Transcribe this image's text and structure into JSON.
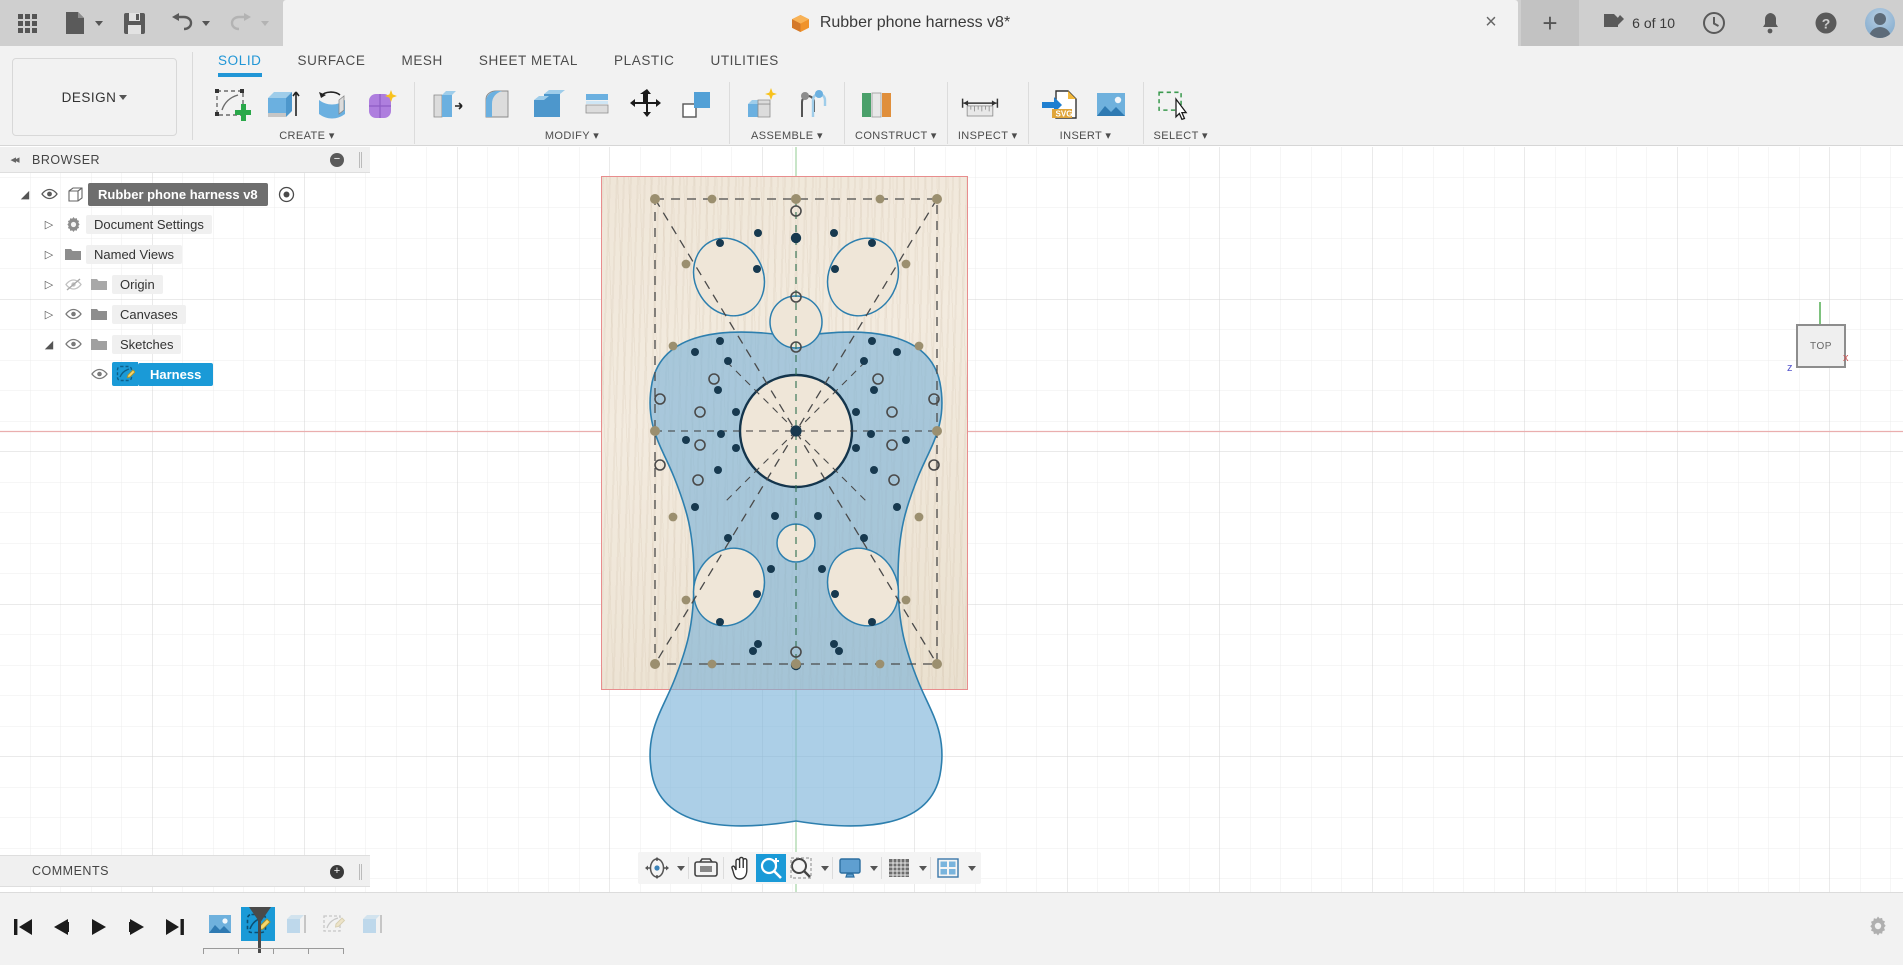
{
  "app": {
    "title": "Rubber phone harness v8*",
    "doc_count": "6 of 10",
    "tab_close": "×",
    "tab_new": "+"
  },
  "quickbar": {
    "apps_icon": "grid-apps-icon",
    "new_icon": "new-document-icon",
    "save_icon": "save-icon",
    "undo_icon": "undo-icon",
    "redo_icon": "redo-icon"
  },
  "workspace": {
    "label": "DESIGN"
  },
  "ribbon": {
    "tabs": [
      {
        "label": "SOLID",
        "active": true
      },
      {
        "label": "SURFACE",
        "active": false
      },
      {
        "label": "MESH",
        "active": false
      },
      {
        "label": "SHEET METAL",
        "active": false
      },
      {
        "label": "PLASTIC",
        "active": false
      },
      {
        "label": "UTILITIES",
        "active": false
      }
    ],
    "panels": [
      {
        "label": "CREATE ▾",
        "icons": [
          "create-sketch-icon",
          "extrude-icon",
          "revolve-icon",
          "form-icon"
        ]
      },
      {
        "label": "MODIFY ▾",
        "icons": [
          "press-pull-icon",
          "fillet-icon",
          "shell-icon",
          "offset-face-icon",
          "move-copy-icon",
          "align-icon"
        ]
      },
      {
        "label": "ASSEMBLE ▾",
        "icons": [
          "new-component-icon",
          "joint-icon"
        ]
      },
      {
        "label": "CONSTRUCT ▾",
        "icons": [
          "offset-plane-icon"
        ]
      },
      {
        "label": "INSPECT ▾",
        "icons": [
          "measure-icon"
        ]
      },
      {
        "label": "INSERT ▾",
        "icons": [
          "insert-svg-icon",
          "canvas-image-icon"
        ]
      },
      {
        "label": "SELECT ▾",
        "icons": [
          "select-window-icon"
        ]
      }
    ]
  },
  "browser": {
    "title": "BROWSER",
    "collapse_icon": "collapse-left-icon",
    "minus_icon": "minus-icon",
    "tree": [
      {
        "label": "Rubber phone harness v8",
        "icon": "component-cube-icon",
        "arrow": "expanded",
        "eye": "visible",
        "state": "selected-grey",
        "indent": 0,
        "extra_eye": true
      },
      {
        "label": "Document Settings",
        "icon": "gear-icon",
        "arrow": "collapsed",
        "eye": "none",
        "state": "normal",
        "indent": 1
      },
      {
        "label": "Named Views",
        "icon": "folder-icon",
        "arrow": "collapsed",
        "eye": "none",
        "state": "normal",
        "indent": 1
      },
      {
        "label": "Origin",
        "icon": "folder-icon",
        "arrow": "collapsed",
        "eye": "hidden",
        "state": "normal",
        "indent": 1
      },
      {
        "label": "Canvases",
        "icon": "folder-icon",
        "arrow": "collapsed",
        "eye": "visible",
        "state": "normal",
        "indent": 1
      },
      {
        "label": "Sketches",
        "icon": "folder-icon",
        "arrow": "expanded",
        "eye": "visible",
        "state": "normal",
        "indent": 1
      },
      {
        "label": "Harness",
        "icon": "sketch-icon",
        "arrow": "none",
        "eye": "visible",
        "state": "selected-blue",
        "indent": 2
      }
    ]
  },
  "comments": {
    "title": "COMMENTS",
    "add_icon": "add-comment-icon"
  },
  "viewport": {
    "viewcube_label": "TOP",
    "axis_z_label": "z",
    "axis_x_label": "x",
    "canvas_name": "harness-canvas-image",
    "navbar": [
      {
        "name": "orbit-icon",
        "caret": true,
        "active": false
      },
      {
        "name": "look-at-icon",
        "caret": false,
        "active": false
      },
      {
        "name": "pan-hand-icon",
        "caret": false,
        "active": false
      },
      {
        "name": "zoom-in-icon",
        "caret": false,
        "active": true
      },
      {
        "name": "zoom-window-icon",
        "caret": true,
        "active": false
      },
      {
        "name": "display-settings-icon",
        "caret": true,
        "active": false
      },
      {
        "name": "grid-snaps-icon",
        "caret": true,
        "active": false
      },
      {
        "name": "viewports-icon",
        "caret": true,
        "active": false
      }
    ]
  },
  "timeline": {
    "playback": [
      {
        "name": "go-to-beginning-icon"
      },
      {
        "name": "step-back-icon"
      },
      {
        "name": "play-icon"
      },
      {
        "name": "step-forward-icon"
      },
      {
        "name": "go-to-end-icon"
      }
    ],
    "features": [
      {
        "name": "timeline-canvas-feature",
        "icon": "canvas-image-icon",
        "selected": false
      },
      {
        "name": "timeline-sketch-feature",
        "icon": "sketch-icon",
        "selected": true
      },
      {
        "name": "timeline-extrude-feature",
        "icon": "extrude-ghost-icon",
        "selected": false
      },
      {
        "name": "timeline-sketch2-feature",
        "icon": "sketch-ghost-icon",
        "selected": false
      },
      {
        "name": "timeline-extrude2-feature",
        "icon": "extrude-ghost2-icon",
        "selected": false
      }
    ],
    "settings_icon": "gear-icon"
  },
  "colors": {
    "accent": "#1a9ad7",
    "ribbon_active": "#2196d6",
    "sketch_blue": "#1a5e86",
    "profile_fill": "#7fb3d5",
    "axis_red": "#e8a9a9",
    "axis_green": "#a9d4a9",
    "canvas_border": "#e88d8d",
    "titlebar": "#cfcfcf",
    "panel_bg": "#f2f2f2"
  }
}
